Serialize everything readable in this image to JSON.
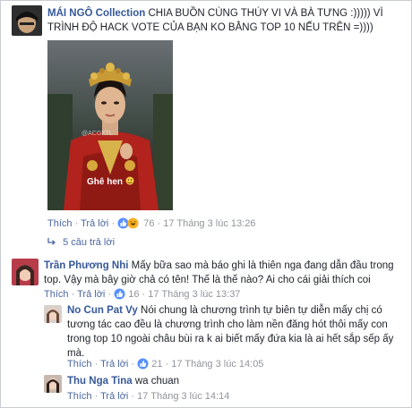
{
  "post": {
    "author": "MÁI NGÔ Collection",
    "text_line1": "CHIA BUỒN CÙNG THÚY VI VÀ BÀ TƯNG :))))) VÌ",
    "text_line2": "TRÌNH ĐỘ HACK VOTE CỦA BẠN KO BẰNG TOP 10 NẾU TRÊN =))))",
    "image_caption": "Ghê hen",
    "image_watermark": "@ACGFTL",
    "like_label": "Thích",
    "reply_label": "Trả lời",
    "reaction_count": "76",
    "timestamp": "17 Tháng 3 lúc 13:26",
    "replies_toggle": "5 câu trả lời"
  },
  "comments": [
    {
      "author": "Trần Phương Nhi",
      "text_line1": "Mấy bữa sao mà báo ghi là thiên nga đang dẫn đầu trong",
      "text_line2": "top. Vậy mà bây giờ chả có tên! Thế là thế nào? Ai cho cái giải thích coi",
      "like_label": "Thích",
      "reply_label": "Trả lời",
      "reaction_count": "16",
      "timestamp": "17 Tháng 3 lúc 13:37"
    },
    {
      "author": "No Cun Pat Vy",
      "text_line1": "Nói chung là chương trình tự biên tự diễn mấy chị có",
      "text_line2": "tương tác cao đều là chương trình cho làm nền đăng hót thôi mấy con",
      "text_line3": "trong top 10 ngoài châu bùi ra k ai biết mấy đứa kia là ai hết sắp sếp ấy",
      "text_line4": "mà.",
      "like_label": "Thích",
      "reply_label": "Trả lời",
      "reaction_count": "21",
      "timestamp": "17 Tháng 3 lúc 14:05"
    },
    {
      "author": "Thu Nga Tina",
      "text": "wa chuan",
      "like_label": "Thích",
      "reply_label": "Trả lời",
      "timestamp": "17 Tháng 3 lúc 14:14"
    }
  ],
  "icons": {
    "like": "like-icon",
    "haha": "haha-icon",
    "wow": "wow-icon",
    "reply_arrow": "reply-arrow-icon"
  },
  "colors": {
    "name": "#365899",
    "link": "#4b67a1",
    "meta": "#90949c",
    "like_blue": "#5890ff",
    "haha_yellow": "#f7b125"
  }
}
